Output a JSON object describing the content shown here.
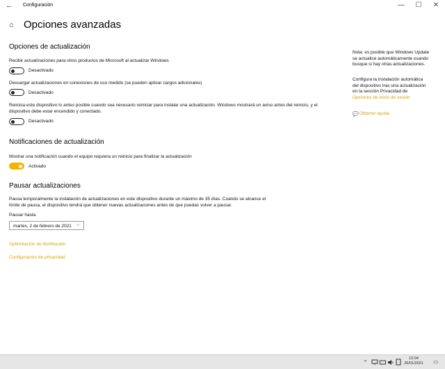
{
  "window": {
    "title": "Configuración",
    "back_icon": "←",
    "minimize": "—",
    "maximize": "☐",
    "close": "✕"
  },
  "page": {
    "home_icon": "⌂",
    "title": "Opciones avanzadas"
  },
  "update_options": {
    "heading": "Opciones de actualización",
    "item1_text": "Recibir actualizaciones para otros productos de Microsoft al actualizar Windows",
    "item1_state": "Desactivado",
    "item2_text": "Descargar actualizaciones en conexiones de uso medido (se pueden aplicar cargos adicionales)",
    "item2_state": "Desactivado",
    "item3_text_line1": "Reinicia este dispositivo lo antes posible cuando sea necesario reiniciar para instalar una actualización. Windows mostrará un aviso antes del reinicio, y el",
    "item3_text_line2": "dispositivo debe estar encendido y conectado.",
    "item3_state": "Desactivado"
  },
  "notifications": {
    "heading": "Notificaciones de actualización",
    "item_text": "Mostrar una notificación cuando el equipo requiera un reinicio para finalizar la actualización",
    "item_state": "Activado"
  },
  "pause": {
    "heading": "Pausar actualizaciones",
    "desc_line1": "Pausa temporalmente la instalación de actualizaciones en este dispositivo durante un máximo de 35 días. Cuando se alcance el",
    "desc_line2": "límite de pausa, el dispositivo tendrá que obtener nuevas actualizaciones antes de que puedas volver a pausar.",
    "label": "Pausar hasta",
    "selected": "martes, 2 de febrero de 2021",
    "chevron": "⌵"
  },
  "links": {
    "delivery": "Optimización de distribución",
    "privacy": "Configuración de privacidad"
  },
  "sidebar": {
    "note_l1": "Nota: es posible que Windows Update",
    "note_l2": "se actualice automáticamente cuando",
    "note_l3": "busque si hay otras actualizaciones.",
    "cfg_l1": "Configura la instalación automática",
    "cfg_l2": "del dispositivo tras una actualización",
    "cfg_l3": "en la sección Privacidad de",
    "cfg_link": "Opciones de inicio de sesión",
    "help_icon": "💬",
    "help_link": "Obtener ayuda"
  },
  "taskbar": {
    "chevron_up": "⌃",
    "time": "12:04",
    "date": "26/01/2021",
    "notif_icon": "▭"
  },
  "colors": {
    "accent": "#f3b300",
    "link": "#d8a200"
  }
}
